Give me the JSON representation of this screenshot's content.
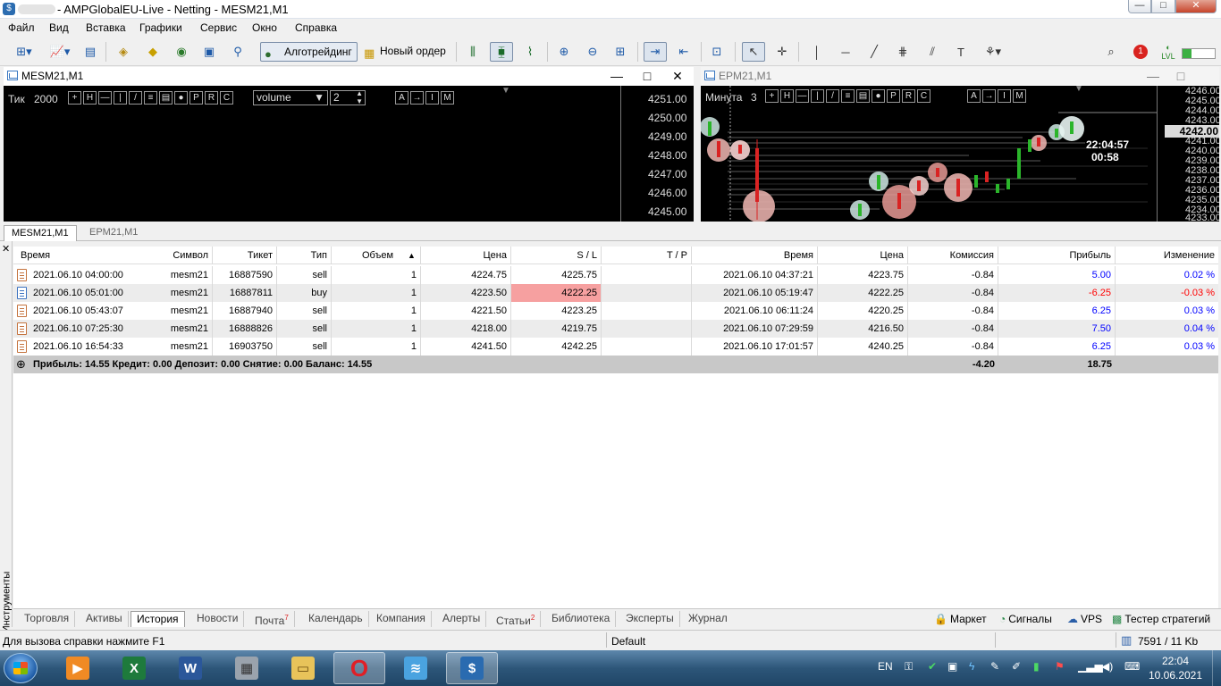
{
  "window": {
    "title": "- AMPGlobalEU-Live - Netting - MESM21,M1",
    "controls": {
      "minimize": "—",
      "maximize": "□",
      "close": "✕"
    }
  },
  "menu": [
    "Файл",
    "Вид",
    "Вставка",
    "Графики",
    "Сервис",
    "Окно",
    "Справка"
  ],
  "toolbar": {
    "algo_label": "Алготрейдинг",
    "new_order_label": "Новый ордер",
    "notification_count": "1",
    "lvl_label": "LVL"
  },
  "chart_left": {
    "title": "MESM21,M1",
    "tick_label": "Тик",
    "tick_value": "2000",
    "volume_select": "volume",
    "volume_value": "2",
    "prices": [
      "4251.00",
      "4250.00",
      "4249.00",
      "4248.00",
      "4247.00",
      "4246.00",
      "4245.00"
    ],
    "ctrl": {
      "min": "—",
      "max": "□",
      "close": "✕"
    }
  },
  "chart_right": {
    "title": "EPM21,M1",
    "period_label": "Минута",
    "period_value": "3",
    "prices": [
      "4246.00",
      "4245.00",
      "4244.00",
      "4243.00",
      "4242.00",
      "4241.00",
      "4240.00",
      "4239.00",
      "4238.00",
      "4237.00",
      "4236.00",
      "4235.00",
      "4234.00",
      "4233.00"
    ],
    "current_price": "4242.00",
    "time": "22:04:57",
    "countdown": "00:58",
    "ctrl": {
      "min": "—",
      "max": "□"
    }
  },
  "chart_tabs": [
    "MESM21,M1",
    "EPM21,M1"
  ],
  "history": {
    "columns": [
      "Время",
      "Символ",
      "Тикет",
      "Тип",
      "Объем",
      "Цена",
      "S / L",
      "T / P",
      "Время",
      "Цена",
      "Комиссия",
      "Прибыль",
      "Изменение"
    ],
    "rows": [
      {
        "open_time": "2021.06.10 04:00:00",
        "symbol": "mesm21",
        "ticket": "16887590",
        "type": "sell",
        "volume": "1",
        "price": "4224.75",
        "sl": "4225.75",
        "tp": "",
        "close_time": "2021.06.10 04:37:21",
        "close_price": "4223.75",
        "commission": "-0.84",
        "profit": "5.00",
        "change": "0.02 %"
      },
      {
        "open_time": "2021.06.10 05:01:00",
        "symbol": "mesm21",
        "ticket": "16887811",
        "type": "buy",
        "volume": "1",
        "price": "4223.50",
        "sl": "4222.25",
        "tp": "",
        "close_time": "2021.06.10 05:19:47",
        "close_price": "4222.25",
        "commission": "-0.84",
        "profit": "-6.25",
        "change": "-0.03 %"
      },
      {
        "open_time": "2021.06.10 05:43:07",
        "symbol": "mesm21",
        "ticket": "16887940",
        "type": "sell",
        "volume": "1",
        "price": "4221.50",
        "sl": "4223.25",
        "tp": "",
        "close_time": "2021.06.10 06:11:24",
        "close_price": "4220.25",
        "commission": "-0.84",
        "profit": "6.25",
        "change": "0.03 %"
      },
      {
        "open_time": "2021.06.10 07:25:30",
        "symbol": "mesm21",
        "ticket": "16888826",
        "type": "sell",
        "volume": "1",
        "price": "4218.00",
        "sl": "4219.75",
        "tp": "",
        "close_time": "2021.06.10 07:29:59",
        "close_price": "4216.50",
        "commission": "-0.84",
        "profit": "7.50",
        "change": "0.04 %"
      },
      {
        "open_time": "2021.06.10 16:54:33",
        "symbol": "mesm21",
        "ticket": "16903750",
        "type": "sell",
        "volume": "1",
        "price": "4241.50",
        "sl": "4242.25",
        "tp": "",
        "close_time": "2021.06.10 17:01:57",
        "close_price": "4240.25",
        "commission": "-0.84",
        "profit": "6.25",
        "change": "0.03 %"
      }
    ],
    "summary": "Прибыль: 14.55  Кредит: 0.00  Депозит: 0.00  Снятие: 0.00  Баланс: 14.55",
    "summary_commission": "-4.20",
    "summary_profit": "18.75"
  },
  "sidebar_label": "Инструменты",
  "bottom_tabs": [
    "Торговля",
    "Активы",
    "История",
    "Новости",
    "Почта",
    "Календарь",
    "Компания",
    "Алерты",
    "Статьи",
    "Библиотека",
    "Эксперты",
    "Журнал"
  ],
  "tab_badges": {
    "mail": "7",
    "articles": "2"
  },
  "right_tabs": [
    "Маркет",
    "Сигналы",
    "VPS",
    "Тестер стратегий"
  ],
  "status": {
    "help": "Для вызова справки нажмите F1",
    "profile": "Default",
    "traffic": "7591 / 11 Kb"
  },
  "taskbar": {
    "lang": "EN",
    "time": "22:04",
    "date": "10.06.2021"
  }
}
